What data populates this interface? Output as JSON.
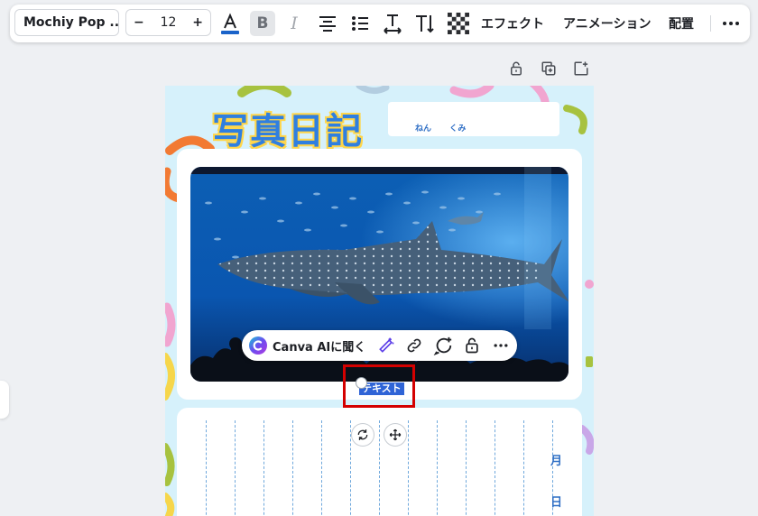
{
  "toolbar": {
    "font_name": "Mochiy Pop ...",
    "font_size": "12",
    "minus_label": "−",
    "plus_label": "+",
    "effects_label": "エフェクト",
    "animation_label": "アニメーション",
    "position_label": "配置"
  },
  "page": {
    "title": "写真日記",
    "name_labels": [
      "ねん",
      "くみ"
    ],
    "date_labels": [
      "月",
      "日"
    ],
    "selected_text": "テキスト"
  },
  "context_menu": {
    "ask_ai_label": "Canva AIに聞く"
  },
  "colors": {
    "accent": "#2f64d6",
    "highlight": "#d40000",
    "page_bg": "#d6f1fb",
    "title_fill": "#2f7fe0",
    "title_stroke": "#ffd64a"
  }
}
